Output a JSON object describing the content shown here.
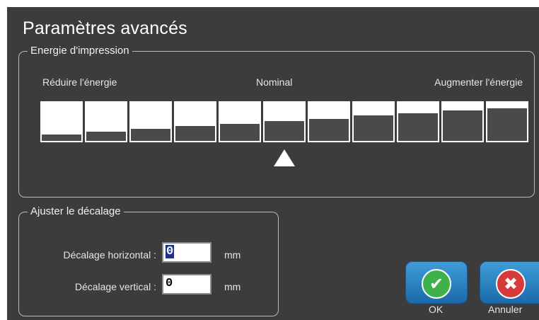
{
  "dialog": {
    "title": "Paramètres avancés"
  },
  "energy": {
    "legend": "Energie d'impression",
    "label_left": "Réduire l'énergie",
    "label_mid": "Nominal",
    "label_right": "Augmenter l'énergie",
    "levels": [
      0.16,
      0.24,
      0.31,
      0.38,
      0.44,
      0.51,
      0.58,
      0.66,
      0.73,
      0.8,
      0.86
    ],
    "selected_index": 5,
    "fill_color": "#4a4a4a"
  },
  "offset": {
    "legend": "Ajuster le décalage",
    "horizontal_label": "Décalage horizontal :",
    "horizontal_value": "0",
    "vertical_label": "Décalage vertical :",
    "vertical_value": "0",
    "unit": "mm"
  },
  "buttons": {
    "ok_label": "OK",
    "cancel_label": "Annuler",
    "ok_icon": "check-icon",
    "cancel_icon": "close-icon"
  }
}
